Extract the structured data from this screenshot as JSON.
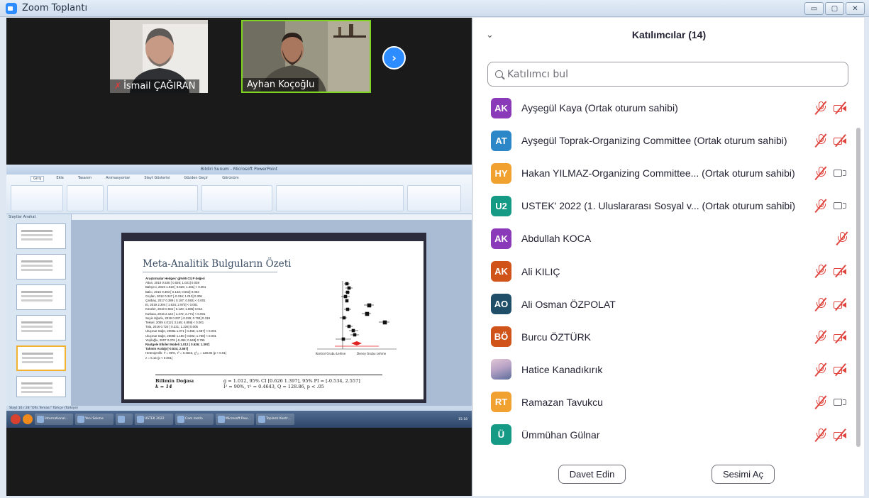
{
  "window": {
    "title": "Zoom Toplantı",
    "controls": [
      "▭",
      "▢",
      "✕"
    ]
  },
  "gallery": {
    "tiles": [
      {
        "name": "İsmail ÇAĞIRAN",
        "muted": true
      },
      {
        "name": "Ayhan Koçoğlu",
        "muted": false
      }
    ],
    "next_button": "›"
  },
  "shared_screen": {
    "ppt_title": "Bildiri Sunum - Microsoft PowerPoint",
    "ribbon_tabs": [
      "Giriş",
      "Ekle",
      "Tasarım",
      "Animasyonlar",
      "Slayt Gösterisi",
      "Gözden Geçir",
      "Görünüm"
    ],
    "thumbs_header": "Slaytlar   Anahat",
    "slide": {
      "title": "Meta-Analitik Bulguların Özeti",
      "studies_header": "Araştırmalar      Hedges' g(%95 CI)  P değeri",
      "studies": [
        "Altun, 2010            0.535 [ 0.026; 1.021]   0.038",
        "Bahçeci, 2019          1.010 [ 0.526; 1.461]  < 0.001",
        "Balcı, 2015            0.393 [ 0.133; 0.653]   0.003",
        "Ceylan, 2012           0.347 [-0.316; 1.013]   0.306",
        "Çakbaş, 2017           0.389 [ 0.187; 0.592]  < 0.001",
        "Ei, 2019               2.304 [ 1.634; 2.973]  < 0.001",
        "Köseler, 2019          0.602 [ 0.120; 1.085]   0.014",
        "Kutluca, 2016          2.122 [ 1.472; 2.771]  < 0.001",
        "Seyis Uğurlu, 2019     0.237 [-0.229; 0.704]   0.319",
        "Teksel, 2009           4.012 [ 3.165; 4.859]  < 0.001",
        "Tola, 2016             0.724 [ 0.221; 1.226]   0.005",
        "Uluçınar Sağır, 2008a  1.071 [ 0.456; 1.687]  < 0.001",
        "Uluçınar Sağır, 2008b  1.180 [ 0.592; 1.768]  < 0.001",
        "Yeşiloğlu, 2007        0.076 [-0.496; 0.648]   0.795",
        "Rastgele Etkiler Modeli 1.012 [ 0.626; 1.397]",
        "Tahmin Aralığı          [-0.534; 2.557]"
      ],
      "heterogeneity": "Heterojenlik: I² = 90%, τ² = 0.4643, χ²₁₃ = 128.86 (p < 0.01)",
      "overall_z": "z = 5.14 (p < 0.001)",
      "axis_left": "Kontrol Grubu Lehine",
      "axis_right": "Deney Grubu Lehine",
      "foot_label1": "Bilimin Doğası",
      "foot_label2": "k = 14",
      "foot_value1": "g = 1.012, 95% CI [0.626 1.397], 95% PI = [-0.534, 2.557]",
      "foot_value2": "I² = 90%, τ² = 0.4643, Q = 128.86, p < .05"
    },
    "status_text": "Slayt 16 / 28   \"Ofis Teması\"   Türkçe (Türkiye)",
    "taskbar_tasks": [
      "İnternational...",
      "Yeni Sekme",
      "",
      "USTEK 2022",
      "Cam metin",
      "Microsoft Pow...",
      "Toplantı Kontr..."
    ],
    "tray_time": "15:18"
  },
  "participants": {
    "title": "Katılımcılar (14)",
    "search_placeholder": "Katılımcı bul",
    "list": [
      {
        "initials": "AK",
        "color": "#8a3ab9",
        "name": "Ayşegül Kaya (Ortak oturum sahibi)",
        "mic": "off",
        "cam": "off"
      },
      {
        "initials": "AT",
        "color": "#2b87c7",
        "name": "Ayşegül Toprak-Organizing Committee (Ortak oturum sahibi)",
        "mic": "off",
        "cam": "off"
      },
      {
        "initials": "HY",
        "color": "#f0a12f",
        "name": "Hakan YILMAZ-Organizing Committee... (Ortak oturum sahibi)",
        "mic": "off",
        "cam": "on"
      },
      {
        "initials": "U2",
        "color": "#159a86",
        "name": "USTEK' 2022 (1. Uluslararası Sosyal v... (Ortak oturum sahibi)",
        "mic": "off",
        "cam": "on"
      },
      {
        "initials": "AK",
        "color": "#8a3ab9",
        "name": "Abdullah KOCA",
        "mic": "off",
        "cam": "none"
      },
      {
        "initials": "AK",
        "color": "#d0531a",
        "name": "Ali KILIÇ",
        "mic": "off",
        "cam": "off"
      },
      {
        "initials": "AO",
        "color": "#1f4e68",
        "name": "Ali Osman ÖZPOLAT",
        "mic": "off",
        "cam": "off"
      },
      {
        "initials": "BÖ",
        "color": "#d0531a",
        "name": "Burcu ÖZTÜRK",
        "mic": "off",
        "cam": "off"
      },
      {
        "initials": "",
        "color": "photo",
        "name": "Hatice Kanadıkırık",
        "mic": "off",
        "cam": "off"
      },
      {
        "initials": "RT",
        "color": "#f0a12f",
        "name": "Ramazan Tavukcu",
        "mic": "off",
        "cam": "on"
      },
      {
        "initials": "Ü",
        "color": "#159a86",
        "name": "Ümmühan Gülnar",
        "mic": "off",
        "cam": "off"
      }
    ],
    "invite_label": "Davet Edin",
    "unmute_label": "Sesimi Aç"
  }
}
